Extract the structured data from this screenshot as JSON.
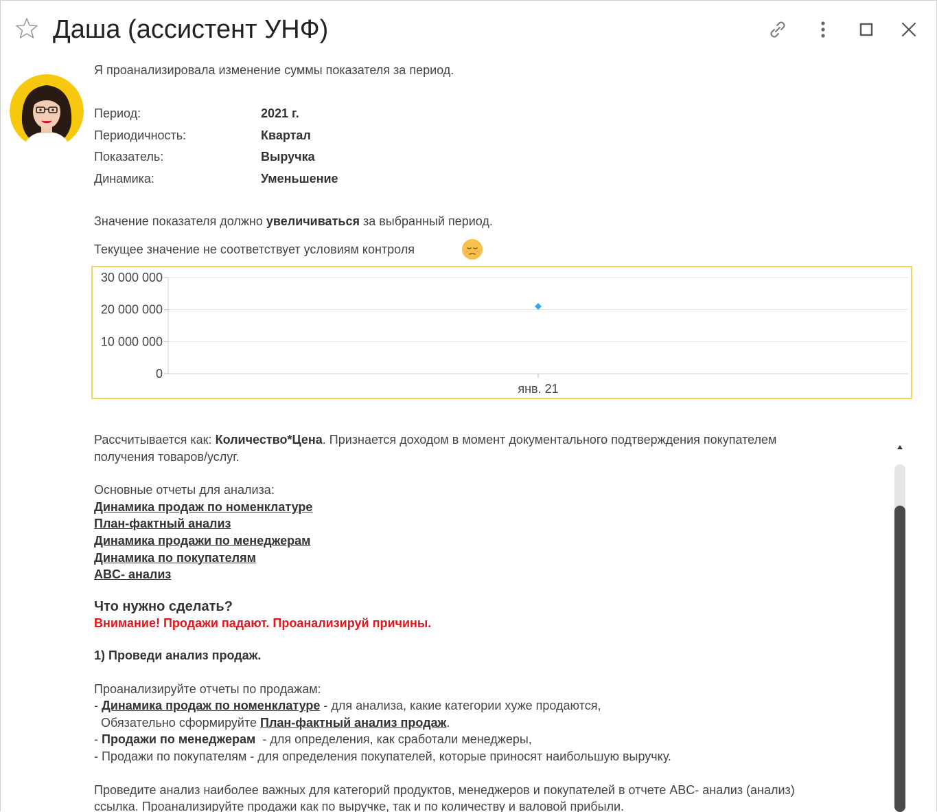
{
  "window": {
    "title": "Даша (ассистент УНФ)"
  },
  "message": {
    "intro": "Я проанализировала изменение суммы показателя за период.",
    "params": [
      {
        "label": "Период:",
        "value": "2021 г."
      },
      {
        "label": "Периодичность:",
        "value": "Квартал"
      },
      {
        "label": "Показатель:",
        "value": "Выручка"
      },
      {
        "label": "Динамика:",
        "value": "Уменьшение"
      }
    ],
    "expect_before": "Значение показателя должно ",
    "expect_bold": "увеличиваться",
    "expect_after": " за выбранный период.",
    "status": "Текущее значение не соответствует условиям контроля"
  },
  "chart_data": {
    "type": "scatter",
    "x": [
      "янв. 21"
    ],
    "y": [
      21000000
    ],
    "yticks": [
      "30 000 000",
      "20 000 000",
      "10 000 000",
      "0"
    ],
    "ylim": [
      0,
      30000000
    ],
    "grid": true,
    "point_color": "#35a8f0",
    "border_color": "#f3d35c"
  },
  "details": {
    "calc_prefix": "Рассчитывается как: ",
    "calc_bold": "Количество*Цена",
    "calc_rest": ". Признается доходом в момент документального подтверждения покупателем",
    "calc_line2": "получения товаров/услуг.",
    "reports_heading": "Основные отчеты для анализа:",
    "reports": [
      "Динамика продаж по номенклатуре ",
      "План-фактный анализ",
      "Динамика продажи по менеджерам",
      "Динамика по покупателям ",
      "ABC- анализ "
    ],
    "todo_heading": "Что нужно сделать?",
    "warning": "Внимание! Продажи падают. Проанализируй причины.",
    "step1": "1) Проведи анализ продаж.",
    "analyze_heading": "Проанализируйте отчеты по продажам:",
    "item1_prefix": "- ",
    "item1_link": "Динамика продаж по номенклатуре",
    "item1_rest": "   - для анализа, какие категории хуже продаются,",
    "item1b_prefix": "  Обязательно сформируйте ",
    "item1b_link": "План-фактный анализ продаж",
    "item1b_rest": ".",
    "item2_prefix": "- ",
    "item2_bold": "Продажи по менеджерам",
    "item2_rest": "  - для определения, как сработали менеджеры,",
    "item3": "- Продажи по покупателям - для определения покупателей, которые приносят наибольшую выручку.",
    "final_line1": "Проведите анализ наиболее важных для категорий продуктов, менеджеров и покупателей в отчете ABC- анализ (анализ)",
    "final_line2": "ссылка. Проанализируйте продажи как по выручке, так и по количеству и валовой прибыли."
  }
}
